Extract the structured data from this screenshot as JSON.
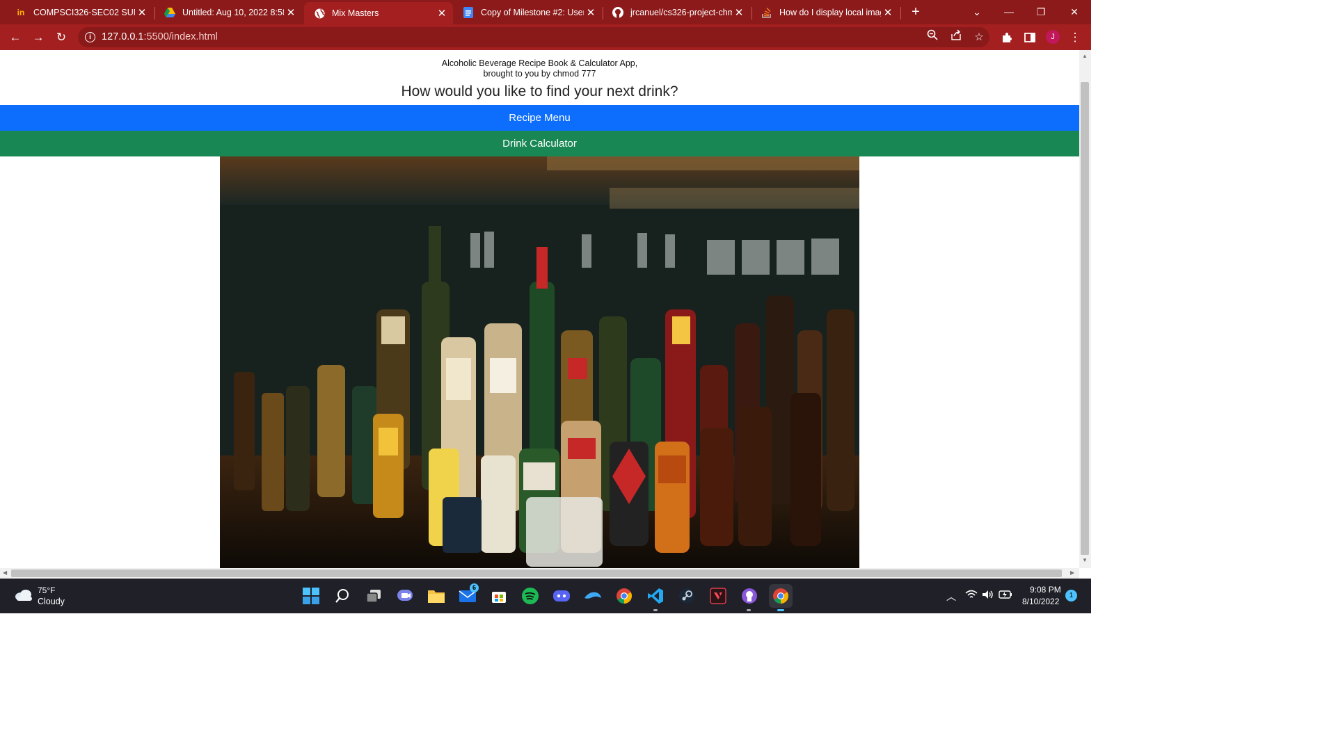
{
  "browser": {
    "tabs": [
      {
        "title": "COMPSCI326-SEC02 SUM2",
        "favicon": "piazza-icon",
        "active": false
      },
      {
        "title": "Untitled: Aug 10, 2022 8:58",
        "favicon": "google-drive-icon",
        "active": false
      },
      {
        "title": "Mix Masters",
        "favicon": "globe-icon",
        "active": true
      },
      {
        "title": "Copy of Milestone #2: User",
        "favicon": "google-docs-icon",
        "active": false
      },
      {
        "title": "jrcanuel/cs326-project-chm",
        "favicon": "github-icon",
        "active": false
      },
      {
        "title": "How do I display local imag",
        "favicon": "stackoverflow-icon",
        "active": false
      }
    ],
    "url_host": "127.0.0.1",
    "url_path": ":5500/index.html",
    "profile_initial": "J",
    "theme_color": "#a41f1f"
  },
  "page": {
    "subtitle_line1": "Alcoholic Beverage Recipe Book & Calculator App,",
    "subtitle_line2": "brought to you by chmod 777",
    "heading": "How would you like to find your next drink?",
    "recipe_button": "Recipe Menu",
    "calculator_button": "Drink Calculator",
    "recipe_button_color": "#0d6efd",
    "calculator_button_color": "#198754",
    "photo_alt": "Bar shelf with liquor bottles"
  },
  "taskbar": {
    "weather_temp": "75°F",
    "weather_desc": "Cloudy",
    "mail_badge": "6",
    "time": "9:08 PM",
    "date": "8/10/2022",
    "notification_count": "1"
  }
}
